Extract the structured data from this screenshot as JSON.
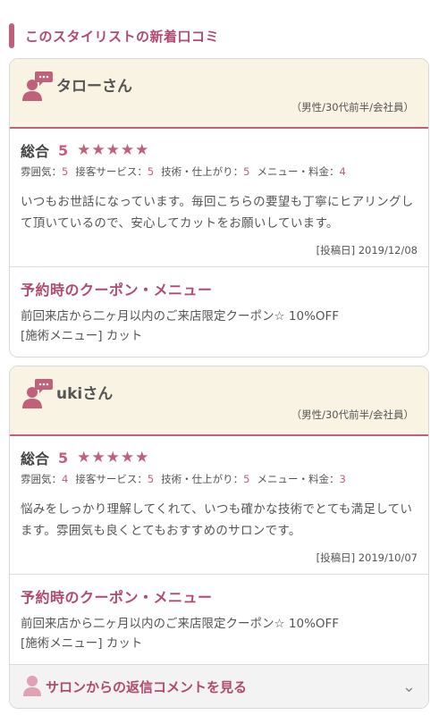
{
  "section": {
    "title": "このスタイリストの新着口コミ"
  },
  "labels": {
    "total": "総合",
    "atmosphere": "雰囲気：",
    "service": "接客サービス：",
    "technique": "技術・仕上がり：",
    "menu_price": "メニュー・料金：",
    "coupon_title": "予約時のクーポン・メニュー"
  },
  "reviews": [
    {
      "name": "タローさん",
      "profile": "（男性/30代前半/会社員）",
      "total_score": "5",
      "stars": "★★★★★",
      "scores": {
        "atmosphere": "5",
        "service": "5",
        "technique": "5",
        "menu_price": "4"
      },
      "comment": "いつもお世話になっています。毎回こちらの要望も丁寧にヒアリングして頂いているので、安心してカットをお願いしています。",
      "date": "[投稿日] 2019/12/08",
      "coupon": "前回来店から二ヶ月以内のご来店限定クーポン☆ 10%OFF",
      "menu": "[施術メニュー] カット"
    },
    {
      "name": "ukiさん",
      "profile": "（男性/30代前半/会社員）",
      "total_score": "5",
      "stars": "★★★★★",
      "scores": {
        "atmosphere": "4",
        "service": "5",
        "technique": "5",
        "menu_price": "3"
      },
      "comment": "悩みをしっかり理解してくれて、いつも確かな技術でとても満足しています。雰囲気も良くとてもおすすめのサロンです。",
      "date": "[投稿日] 2019/10/07",
      "coupon": "前回来店から二ヶ月以内のご来店限定クーポン☆ 10%OFF",
      "menu": "[施術メニュー] カット",
      "reply_label": "サロンからの返信コメントを見る"
    }
  ],
  "colors": {
    "accent": "#c0607a",
    "header_bg": "#f8f3e3"
  },
  "icons": {
    "reviewer": "user-chat-icon",
    "reply": "user-icon",
    "expand": "chevron-down-icon"
  }
}
